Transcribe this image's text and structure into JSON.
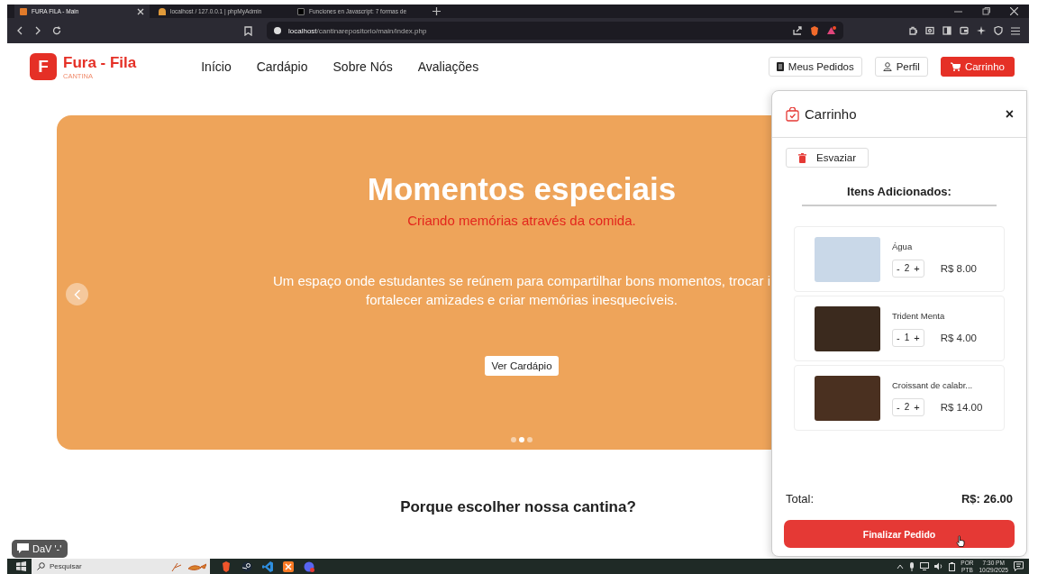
{
  "browser": {
    "tabs": [
      {
        "title": "FURA FILA - Main",
        "selected": true
      },
      {
        "title": "localhost / 127.0.0.1 | phpMyAdmin",
        "selected": false
      },
      {
        "title": "Funciones en Javascript: 7 formas de",
        "selected": false
      }
    ],
    "url_host": "localhost",
    "url_path": "/cantinarepositorio/main/index.php"
  },
  "header": {
    "logo_letter": "F",
    "brand": "Fura - Fila",
    "tagline": "CANTINA",
    "nav": [
      "Início",
      "Cardápio",
      "Sobre Nós",
      "Avaliações"
    ],
    "buttons": [
      {
        "label": "Meus Pedidos",
        "kind": "orders"
      },
      {
        "label": "Perfil",
        "kind": "profile"
      },
      {
        "label": "Carrinho",
        "kind": "cart"
      }
    ]
  },
  "hero": {
    "title": "Momentos especiais",
    "subtitle": "Criando memórias através da comida.",
    "lines": [
      "Um espaço onde estudantes se reúnem para compartilhar bons momentos, trocar i",
      "fortalecer amizades e criar memórias inesquecíveis."
    ],
    "button": "Ver Cardápio",
    "dots": [
      {
        "selected": false
      },
      {
        "selected": true
      },
      {
        "selected": false
      }
    ]
  },
  "section_title": "Porque escolher nossa cantina?",
  "cart": {
    "title": "Carrinho",
    "close": "×",
    "clear": "Esvaziar",
    "items_heading": "Itens Adicionados:",
    "items": [
      {
        "name": "Água",
        "qty": "2",
        "price": "R$ 8.00"
      },
      {
        "name": "Trident Menta",
        "qty": "1",
        "price": "R$ 4.00"
      },
      {
        "name": "Croissant de calabr...",
        "qty": "2",
        "price": "R$ 14.00"
      }
    ],
    "minus": "-",
    "plus": "+",
    "total_label": "Total:",
    "total": "R$: 26.00",
    "checkout": "Finalizar Pedido"
  },
  "overlay_label": "DaV '-'",
  "taskbar": {
    "search_placeholder": "Pesquisar",
    "lang": [
      "POR",
      "PTB"
    ],
    "time": "7:30 PM",
    "date": "10/29/2025"
  }
}
